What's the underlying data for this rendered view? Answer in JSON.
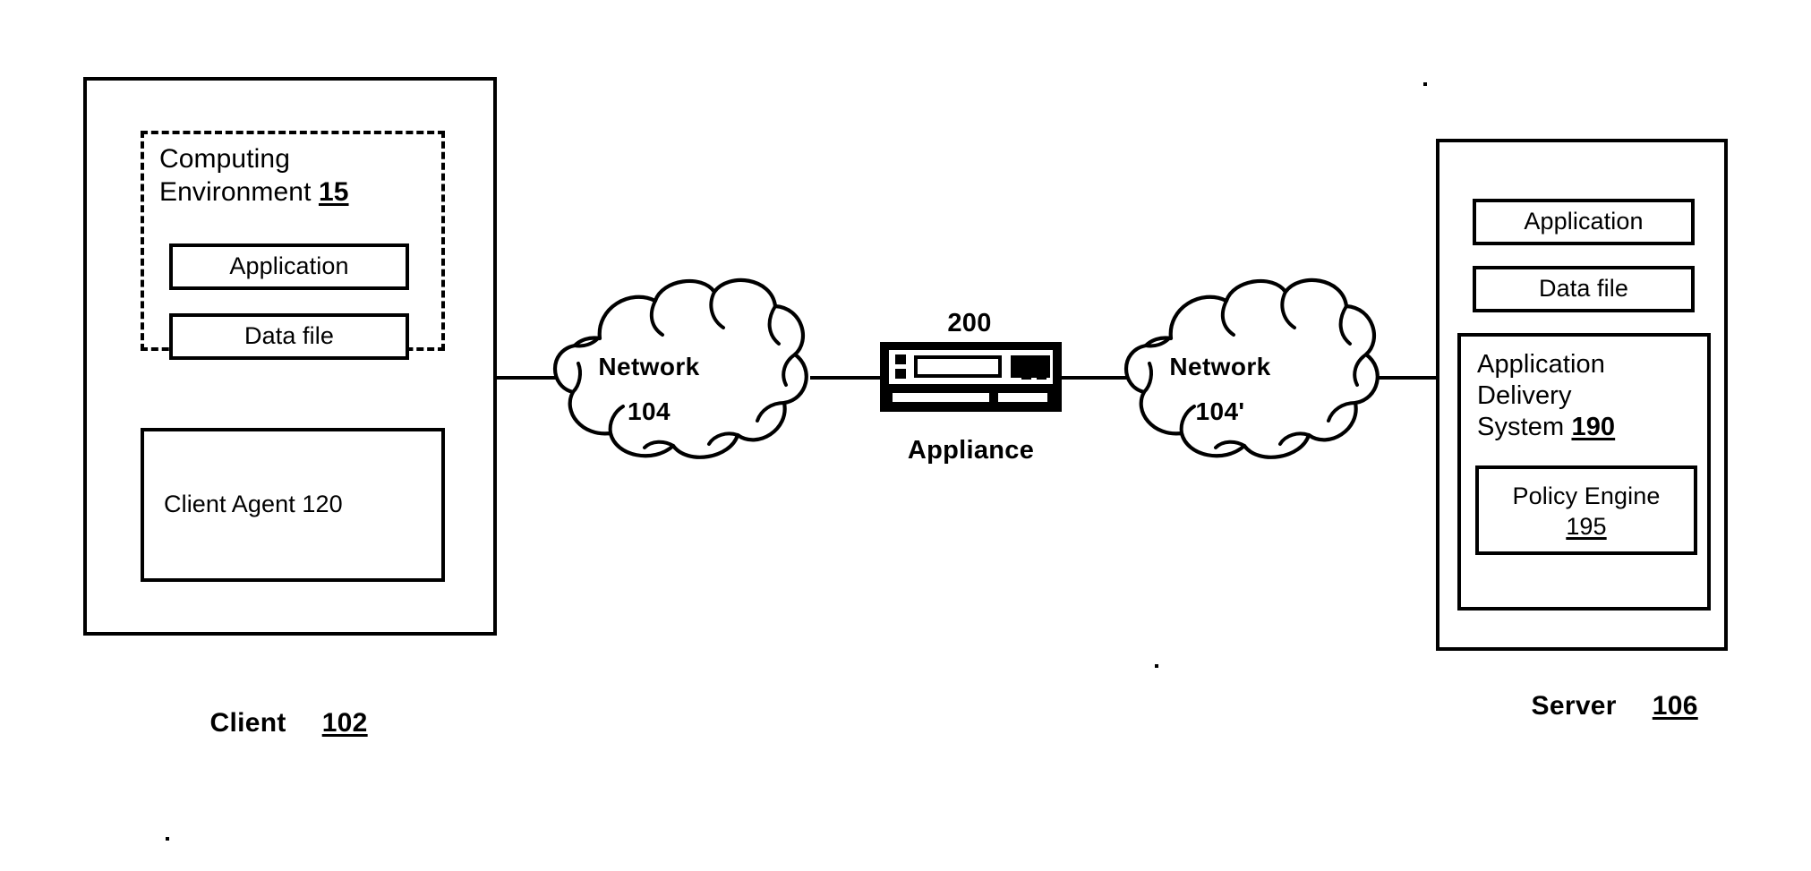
{
  "figure": {
    "type": "network-architecture-block-diagram",
    "background": "#ffffff",
    "line_color": "#000000"
  },
  "client": {
    "caption_label": "Client",
    "caption_ref": "102",
    "computing_environment": {
      "title_line1": "Computing",
      "title_line2": "Environment",
      "ref": "15",
      "modules": [
        {
          "label": "Application"
        },
        {
          "label": "Data file"
        }
      ]
    },
    "client_agent": {
      "label": "Client Agent 120"
    }
  },
  "network_left": {
    "line1": "Network",
    "line2": "104",
    "icon": "cloud-icon"
  },
  "appliance": {
    "ref": "200",
    "label": "Appliance",
    "icon": "rack-appliance-icon"
  },
  "network_right": {
    "line1": "Network",
    "line2": "104'",
    "icon": "cloud-icon"
  },
  "server": {
    "caption_label": "Server",
    "caption_ref": "106",
    "modules": [
      {
        "label": "Application"
      },
      {
        "label": "Data file"
      }
    ],
    "application_delivery_system": {
      "title_line1": "Application",
      "title_line2": "Delivery",
      "title_line3": "System",
      "ref": "190",
      "policy_engine": {
        "label": "Policy Engine",
        "ref": "195"
      }
    }
  },
  "connections": [
    {
      "from": "client",
      "to": "network_left"
    },
    {
      "from": "network_left",
      "to": "appliance"
    },
    {
      "from": "appliance",
      "to": "network_right"
    },
    {
      "from": "network_right",
      "to": "server"
    }
  ]
}
